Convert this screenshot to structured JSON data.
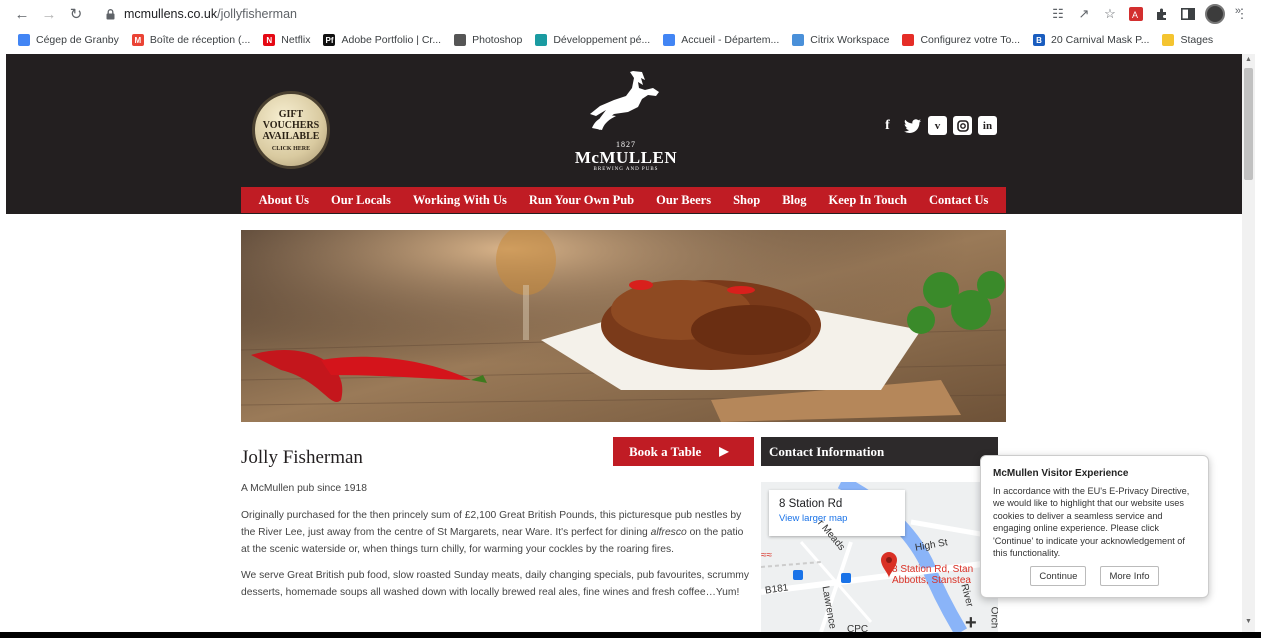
{
  "browser": {
    "url_host": "mcmullens.co.uk",
    "url_path": "/jollyfisherman",
    "bookmarks": [
      {
        "label": "Cégep de Granby",
        "color": "#4285f4",
        "glyph": ""
      },
      {
        "label": "Boîte de réception (...",
        "color": "#ea4335",
        "glyph": "M"
      },
      {
        "label": "Netflix",
        "color": "#e50914",
        "glyph": "N"
      },
      {
        "label": "Adobe Portfolio | Cr...",
        "color": "#111111",
        "glyph": "Pf"
      },
      {
        "label": "Photoshop",
        "color": "#555555",
        "glyph": ""
      },
      {
        "label": "Développement pé...",
        "color": "#1a9ba1",
        "glyph": ""
      },
      {
        "label": "Accueil - Départem...",
        "color": "#4285f4",
        "glyph": ""
      },
      {
        "label": "Citrix Workspace",
        "color": "#4a90d9",
        "glyph": ""
      },
      {
        "label": "Configurez votre To...",
        "color": "#e52d27",
        "glyph": ""
      },
      {
        "label": "20 Carnival Mask P...",
        "color": "#1a5dbf",
        "glyph": "B"
      },
      {
        "label": "Stages",
        "color": "#f4c430",
        "glyph": ""
      }
    ],
    "more": "»"
  },
  "header": {
    "gift_line1": "GIFT",
    "gift_line2": "VOUCHERS",
    "gift_line3": "AVAILABLE",
    "gift_cta": "CLICK HERE",
    "logo_year": "1827",
    "logo_brand": "McMULLEN",
    "logo_sub": "BREWING AND PUBS",
    "social": [
      "f",
      "t",
      "v",
      "ig",
      "in"
    ]
  },
  "nav": {
    "items": [
      "About Us",
      "Our Locals",
      "Working With Us",
      "Run Your Own Pub",
      "Our Beers",
      "Shop",
      "Blog",
      "Keep In Touch",
      "Contact Us"
    ]
  },
  "content": {
    "title": "Jolly Fisherman",
    "p0": "A McMullen pub since 1918",
    "p1a": "Originally purchased for the then princely sum of £2,100 Great British Pounds, this picturesque pub nestles by the River Lee, just away from the centre of St Margarets, near Ware. It's perfect for dining ",
    "p1em": "alfresco",
    "p1b": " on the patio at the scenic waterside or, when things turn chilly, for warming your cockles by the roaring fires.",
    "p2": "We serve Great British pub food, slow roasted Sunday meats, daily changing specials, pub favourites, scrummy desserts, homemade soups all washed down with locally brewed real ales, fine wines and fresh coffee…Yum!",
    "book_label": "Book a Table",
    "contact_heading": "Contact Information"
  },
  "map": {
    "address": "8 Station Rd",
    "link": "View larger map",
    "street_high": "High St",
    "street_meads": "r Meads",
    "street_b181": "B181",
    "street_lawrence": "Lawrence",
    "street_river": "River",
    "street_orch": "Orch",
    "street_cpc": "CPC",
    "pin_label_1": "8 Station Rd, Stan",
    "pin_label_2": "Abbotts, Stanstea",
    "rail": "≈≈",
    "zoom_in": "+"
  },
  "cookie": {
    "title": "McMullen Visitor Experience",
    "body": "In accordance with the EU's E-Privacy Directive, we would like to highlight that our website uses cookies to deliver a seamless service and engaging online experience. Please click 'Continue' to indicate your acknowledgement of this functionality.",
    "continue": "Continue",
    "more_info": "More Info"
  },
  "colors": {
    "header_bg": "#231f20",
    "nav_red": "#c01c24"
  }
}
